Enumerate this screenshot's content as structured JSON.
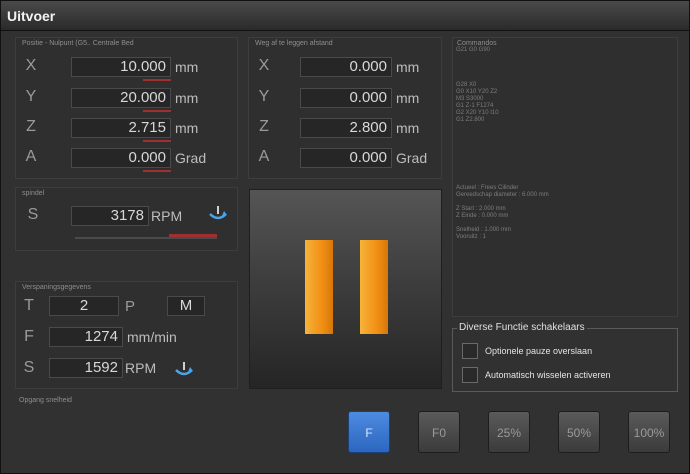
{
  "window": {
    "title": "Uitvoer"
  },
  "position_panel": {
    "title": "Positie - Nulpunt (G5.. Centrale Bed",
    "rows": [
      {
        "axis": "X",
        "value": "10.000",
        "unit": "mm"
      },
      {
        "axis": "Y",
        "value": "20.000",
        "unit": "mm"
      },
      {
        "axis": "Z",
        "value": "2.715",
        "unit": "mm"
      },
      {
        "axis": "A",
        "value": "0.000",
        "unit": "Grad"
      }
    ]
  },
  "distance_panel": {
    "title": "Weg af te leggen afstand",
    "rows": [
      {
        "axis": "X",
        "value": "0.000",
        "unit": "mm"
      },
      {
        "axis": "Y",
        "value": "0.000",
        "unit": "mm"
      },
      {
        "axis": "Z",
        "value": "2.800",
        "unit": "mm"
      },
      {
        "axis": "A",
        "value": "0.000",
        "unit": "Grad"
      }
    ]
  },
  "spindle_panel": {
    "title": "spindel",
    "label": "S",
    "value": "3178",
    "unit": "RPM"
  },
  "commands_panel": {
    "title": "Commandos",
    "lines": [
      "G21 G0 G90",
      "",
      "",
      "",
      "",
      "G28 X0",
      "G0 X10 Y20 Z2",
      "M3 S3000",
      "G1 Z-1 F1274",
      "G2 X20 Y10 I10",
      "G1 Z2.800"
    ],
    "tool_lines": [
      "Actueel : Frees Cilinder",
      "Gereedschap diameter : 6.000 mm",
      "",
      "Z Start : 2.000 mm",
      "Z Einde : 0.000 mm",
      "",
      "Snelheid : 1.000 mm",
      "Vooruitz : 1"
    ]
  },
  "machining_panel": {
    "title": "Verspaningsgegevens",
    "t_label": "T",
    "t_value": "2",
    "p_label": "P",
    "m_label": "M",
    "f_label": "F",
    "f_value": "1274",
    "f_unit": "mm/min",
    "s_label": "S",
    "s_value": "1592",
    "s_unit": "RPM"
  },
  "bottom_label": "Opgang snelheid",
  "switches": {
    "title": "Diverse Functie schakelaars",
    "items": [
      {
        "label": "Optionele pauze overslaan"
      },
      {
        "label": "Automatisch wisselen activeren"
      }
    ]
  },
  "override_buttons": [
    {
      "label": "F",
      "active": true
    },
    {
      "label": "F0",
      "active": false
    },
    {
      "label": "25%",
      "active": false
    },
    {
      "label": "50%",
      "active": false
    },
    {
      "label": "100%",
      "active": false
    }
  ],
  "colors": {
    "accent_orange": "#f28f14",
    "active_blue": "#2c66c0",
    "load_red": "#a03030"
  },
  "icons": {
    "pause": "pause-icon",
    "spindle": "spindle-rotation-icon"
  }
}
